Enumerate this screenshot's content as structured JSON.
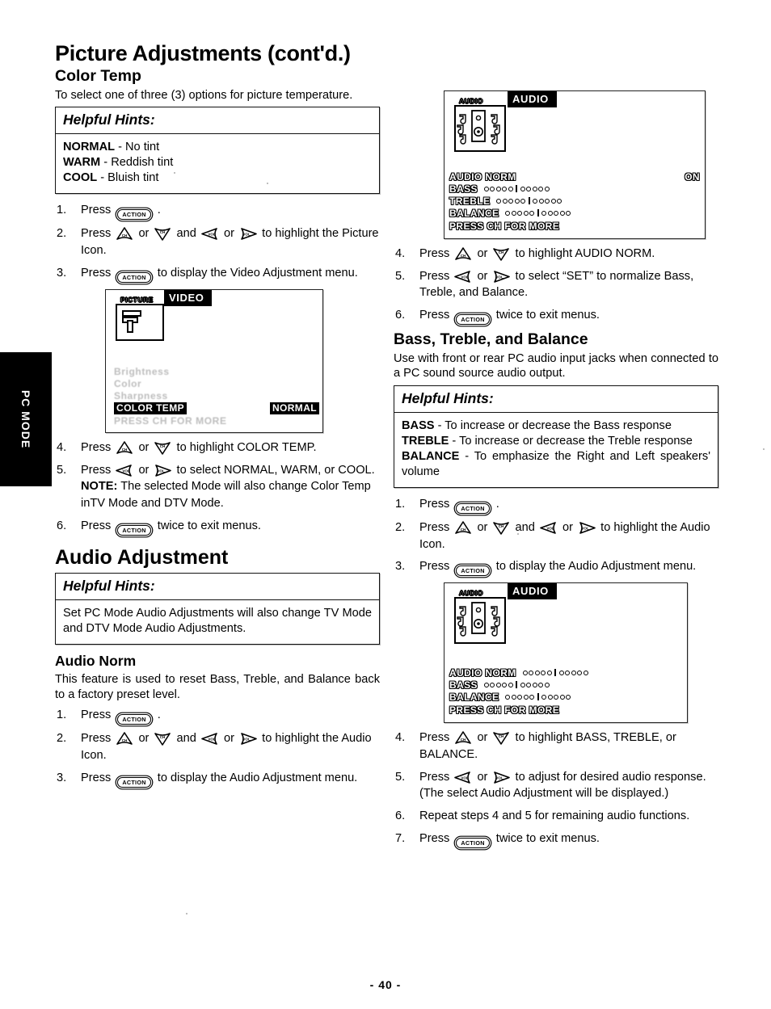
{
  "page": {
    "title": "Picture Adjustments (cont'd.)",
    "footer": "- 40 -",
    "mode_tab": "PC MODE"
  },
  "left_column": {
    "color_temp": {
      "heading": "Color Temp",
      "intro": "To select one of three (3) options for picture temperature.",
      "hints": {
        "title": "Helpful Hints:",
        "lines": [
          {
            "term": "NORMAL",
            "text": " - No tint"
          },
          {
            "term": "WARM",
            "text": " - Reddish tint"
          },
          {
            "term": "COOL",
            "text": " - Bluish tint"
          }
        ]
      },
      "steps_a": [
        {
          "num": "1.",
          "text": "Press  [ACTION]  ."
        },
        {
          "num": "2.",
          "text": "Press  [CH-UP]  or  [CH-DOWN]  and  [VOL-LEFT]  or  [VOL-RIGHT]  to highlight the Picture Icon."
        },
        {
          "num": "3.",
          "text": "Press  [ACTION]  to display the Video Adjustment menu."
        }
      ],
      "steps_b": [
        {
          "num": "4.",
          "text": "Press  [CH-UP]  or  [CH-DOWN]  to highlight COLOR TEMP."
        },
        {
          "num": "5.",
          "text": "Press  [VOL-LEFT]  or  [VOL-RIGHT]  to select NORMAL, WARM, or COOL."
        },
        {
          "num": "5note",
          "text": "NOTE: The selected Mode will also change Color Temp inTV Mode and DTV Mode."
        },
        {
          "num": "6.",
          "text": "Press  [ACTION]  twice to exit menus."
        }
      ],
      "note_label": "NOTE:",
      "note_text": " The selected Mode will also change Color Temp inTV Mode and DTV Mode.",
      "osd": {
        "icon_tag": "PICTURE",
        "title": "VIDEO",
        "faded_rows": [
          "Brightness",
          "Color",
          "Sharpness"
        ],
        "highlight_row_label": "COLOR TEMP",
        "highlight_row_value": "NORMAL",
        "press_more": "PRESS CH FOR MORE"
      }
    },
    "audio_adjustment": {
      "heading": "Audio Adjustment",
      "hints": {
        "title": "Helpful Hints:",
        "body": "Set PC Mode Audio Adjustments will also change TV Mode and DTV Mode Audio Adjustments."
      },
      "audio_norm": {
        "heading": "Audio Norm",
        "intro": "This feature is used to reset Bass, Treble, and Balance back to a factory preset level."
      }
    }
  },
  "right_column": {
    "osd_top": {
      "icon_tag": "AUDIO",
      "title": "AUDIO",
      "rows": [
        {
          "label": "AUDIO NORM",
          "value": "ON",
          "slider": false,
          "highlight": true
        },
        {
          "label": "BASS",
          "value": "",
          "slider": true,
          "highlight": true
        },
        {
          "label": "TREBLE",
          "value": "",
          "slider": true,
          "highlight": true
        },
        {
          "label": "BALANCE",
          "value": "",
          "slider": true,
          "highlight": true
        }
      ],
      "press_more": "PRESS  CH  FOR MORE"
    },
    "audio_norm_steps": [
      {
        "num": "4.",
        "text": "Press  [CH-UP]  or  [CH-DOWN]  to highlight AUDIO NORM."
      },
      {
        "num": "5.",
        "text": "Press  [VOL-LEFT]  or  [VOL-RIGHT]  to select \"SET\" to normalize Bass, Treble, and Balance."
      },
      {
        "num": "6.",
        "text": "Press  [ACTION]  twice to exit menus."
      }
    ],
    "bass_treble_balance": {
      "heading": "Bass, Treble, and Balance",
      "intro": "Use with front or rear PC audio input jacks when connected to a PC sound source audio output.",
      "hints": {
        "title": "Helpful Hints:",
        "lines": [
          {
            "term": "BASS",
            "text": " - To increase or decrease the Bass response"
          },
          {
            "term": "TREBLE",
            "text": " - To increase or decrease the Treble response"
          },
          {
            "term": "BALANCE",
            "text": " - To emphasize the Right and Left speakers' volume"
          }
        ]
      }
    },
    "osd_bottom": {
      "icon_tag": "AUDIO",
      "title": "AUDIO",
      "rows": [
        {
          "label": "AUDIO NORM",
          "slider": true
        },
        {
          "label": "BASS",
          "slider": true
        },
        {
          "label": "BALANCE",
          "slider": true
        }
      ],
      "press_more": "PRESS  CH  FOR MORE"
    }
  },
  "shared_steps": {
    "picture_step1": {
      "num": "1.",
      "pre": "Press",
      "post": "."
    },
    "picture_step2": {
      "num": "2.",
      "pre": "Press",
      "mid1": "or",
      "mid2": "and",
      "mid3": "or",
      "post": "to highlight the Picture Icon."
    },
    "picture_step3": {
      "num": "3.",
      "pre": "Press",
      "post": "to display the Video Adjustment menu."
    },
    "audio_step1": {
      "num": "1.",
      "pre": "Press",
      "post": "."
    },
    "audio_step2": {
      "num": "2.",
      "pre": "Press",
      "mid1": "or",
      "mid2": "and",
      "mid3": "or",
      "post": "to highlight the Audio Icon."
    },
    "audio_step3_left": {
      "num": "3.",
      "pre": "Press",
      "post": "to display the Audio Adjustment menu."
    },
    "audio_step3_right": {
      "num": "3.",
      "pre": "Press",
      "post": "to display the Audio Adjustment menu."
    },
    "color_step4": {
      "num": "4.",
      "pre": "Press",
      "mid1": "or",
      "post": "to highlight COLOR TEMP."
    },
    "color_step5": {
      "num": "5.",
      "pre": "Press",
      "mid1": "or",
      "post": "to select NORMAL, WARM, or COOL."
    },
    "color_step6": {
      "num": "6.",
      "pre": "Press",
      "post": "twice to exit menus."
    },
    "anorm_step4": {
      "num": "4.",
      "pre": "Press",
      "mid1": "or",
      "post": "to highlight AUDIO NORM."
    },
    "anorm_step5": {
      "num": "5.",
      "pre": "Press",
      "mid1": "or",
      "post": "to select “SET” to normalize Bass, Treble, and Balance."
    },
    "anorm_step6": {
      "num": "6.",
      "pre": "Press",
      "post": "twice to exit menus."
    },
    "btb_step4": {
      "num": "4.",
      "pre": "Press",
      "mid1": "or",
      "post": "to highlight BASS, TREBLE, or BALANCE."
    },
    "btb_step5": {
      "num": "5.",
      "pre": "Press",
      "mid1": "or",
      "post": "to adjust  for desired audio response. (The select Audio Adjustment will be displayed.)"
    },
    "btb_step6": {
      "num": "6.",
      "text": "Repeat steps 4 and 5 for remaining audio functions."
    },
    "btb_step7": {
      "num": "7.",
      "pre": "Press",
      "post": "twice to exit menus."
    }
  },
  "keys": {
    "action_label": "ACTION",
    "ch_up_label": "CH",
    "ch_down_label": "CH",
    "vol_left_label": "VOL",
    "vol_right_label": "VOL"
  }
}
